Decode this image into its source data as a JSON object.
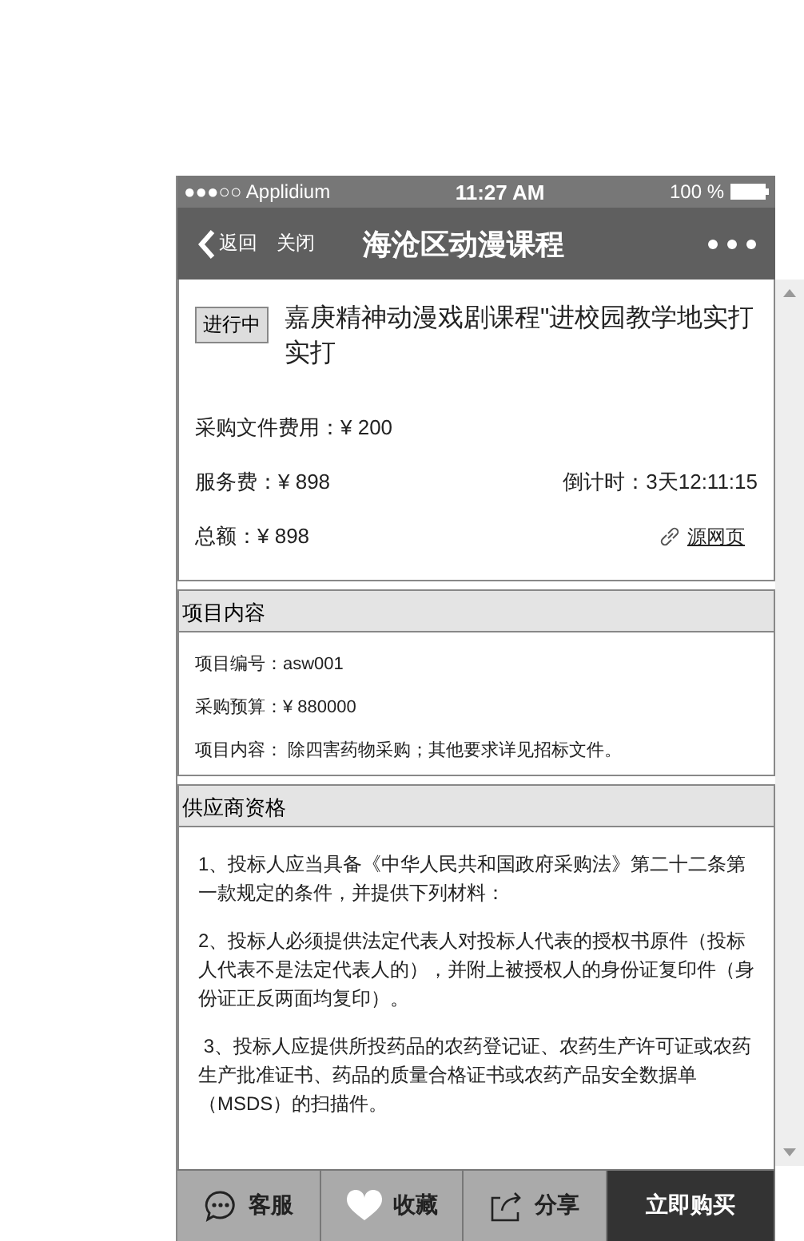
{
  "status_bar": {
    "carrier": "●●●○○ Applidium",
    "time": "11:27 AM",
    "battery": "100 %"
  },
  "nav_bar": {
    "back": "返回",
    "close": "关闭",
    "title": "海沧区动漫课程"
  },
  "project": {
    "status": "进行中",
    "title": "嘉庚精神动漫戏剧课程\"进校园教学地实打实打",
    "doc_fee": "采购文件费用：¥ 200",
    "service_fee": "服务费：¥ 898",
    "countdown": "倒计时：3天12:11:15",
    "total": "总额：¥ 898",
    "source_link": "源网页"
  },
  "sections": [
    {
      "title": "项目内容",
      "kind": "details",
      "lines": [
        "项目编号：asw001",
        "采购预算：¥ 880000",
        "项目内容： 除四害药物采购；其他要求详见招标文件。"
      ]
    },
    {
      "title": "供应商资格",
      "kind": "qualifications",
      "lines": [
        "1、投标人应当具备《中华人民共和国政府采购法》第二十二条第一款规定的条件，并提供下列材料：",
        "2、投标人必须提供法定代表人对投标人代表的授权书原件（投标人代表不是法定代表人的），并附上被授权人的身份证复印件（身份证正反两面均复印）。",
        " 3、投标人应提供所投药品的农药登记证、农药生产许可证或农药生产批准证书、药品的质量合格证书或农药产品安全数据单（MSDS）的扫描件。"
      ]
    }
  ],
  "bottom_bar": [
    {
      "kind": "chat",
      "label": "客服"
    },
    {
      "kind": "heart",
      "label": "收藏"
    },
    {
      "kind": "share",
      "label": "分享"
    },
    {
      "kind": "buy",
      "label": "立即购买"
    }
  ]
}
